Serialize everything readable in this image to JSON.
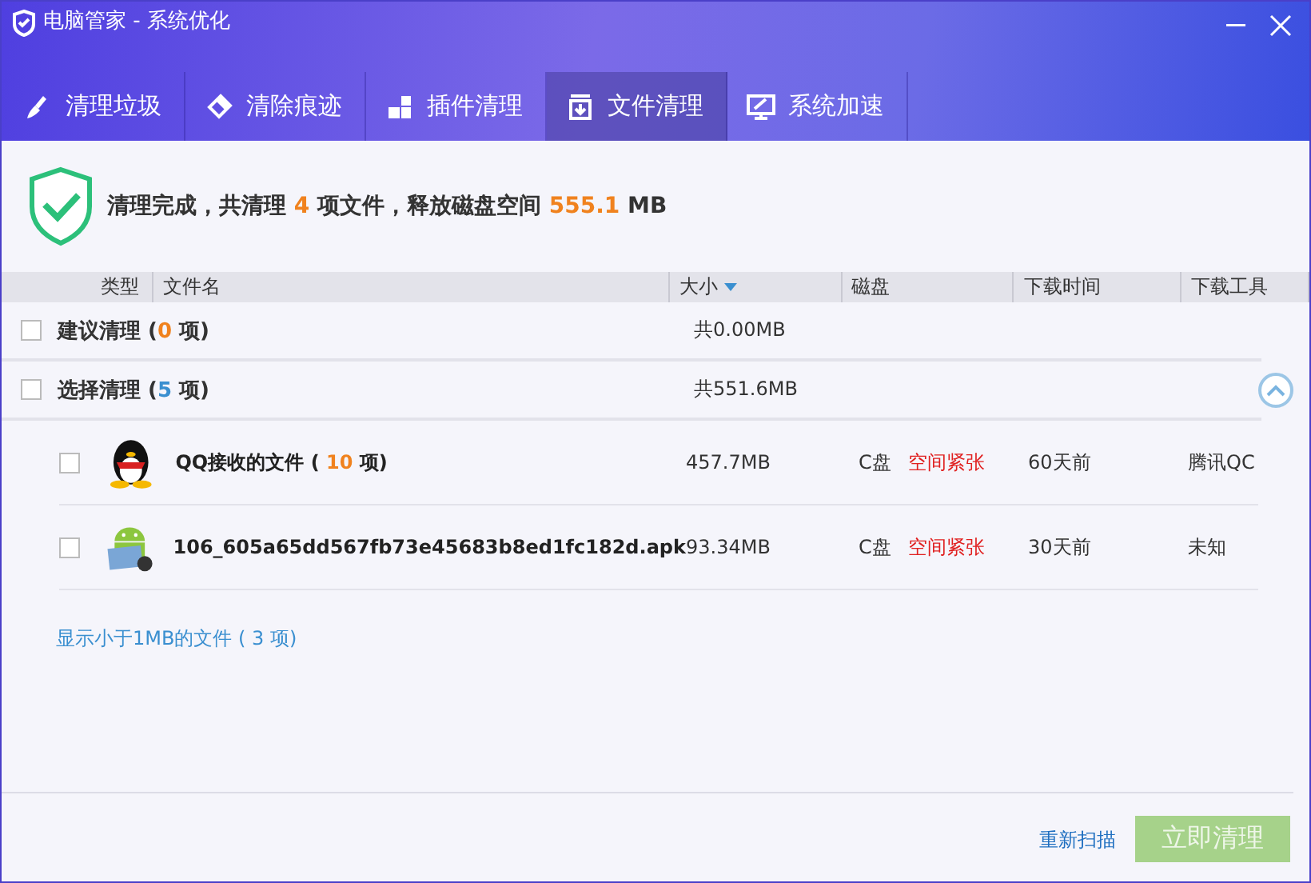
{
  "window": {
    "title": "电脑管家 - 系统优化"
  },
  "tabs": [
    {
      "label": "清理垃圾",
      "selected": false
    },
    {
      "label": "清除痕迹",
      "selected": false
    },
    {
      "label": "插件清理",
      "selected": false
    },
    {
      "label": "文件清理",
      "selected": true
    },
    {
      "label": "系统加速",
      "selected": false
    }
  ],
  "summary": [
    {
      "text": "清理完成，共清理 ",
      "highlight": false
    },
    {
      "text": "4",
      "highlight": true
    },
    {
      "text": " 项文件，释放磁盘空间 ",
      "highlight": false
    },
    {
      "text": "555.1",
      "highlight": true
    },
    {
      "text": " MB",
      "highlight": false
    }
  ],
  "table": {
    "columns": [
      {
        "label": "类型",
        "sorted": false
      },
      {
        "label": "文件名",
        "sorted": false
      },
      {
        "label": "大小",
        "sorted": true
      },
      {
        "label": "磁盘",
        "sorted": false
      },
      {
        "label": "下载时间",
        "sorted": false
      },
      {
        "label": "下载工具",
        "sorted": false
      }
    ],
    "groups": [
      {
        "name": "建议清理 (",
        "count": "0",
        "count_suffix": " 项)",
        "color": "#f0821e",
        "size": "共0.00MB",
        "checked": false
      },
      {
        "name": "选择清理 (",
        "count": "5",
        "count_suffix": " 项)",
        "color": "#3a8fd0",
        "size": "共551.6MB",
        "checked": false,
        "expanded": true,
        "rows": [
          {
            "name": "QQ接收的文件 ( ",
            "count": "10",
            "count_suffix": " 项)",
            "size": "457.7MB",
            "disk": "C盘",
            "disk_status": "空间紧张",
            "disk_alert": true,
            "time": "60天前",
            "tool": "腾讯QC",
            "checked": false
          },
          {
            "name": "106_605a65dd567fb73e45683b8ed1fc182d.apk",
            "size": "93.34MB",
            "disk": "C盘",
            "disk_status": "空间紧张",
            "disk_alert": true,
            "time": "30天前",
            "tool": "未知",
            "checked": false
          }
        ]
      }
    ]
  },
  "small_files_link": "显示小于1MB的文件 ( 3 项)",
  "footer": {
    "rescan": "重新扫描",
    "clean_button": {
      "label": "立即清理",
      "disabled": true
    }
  }
}
